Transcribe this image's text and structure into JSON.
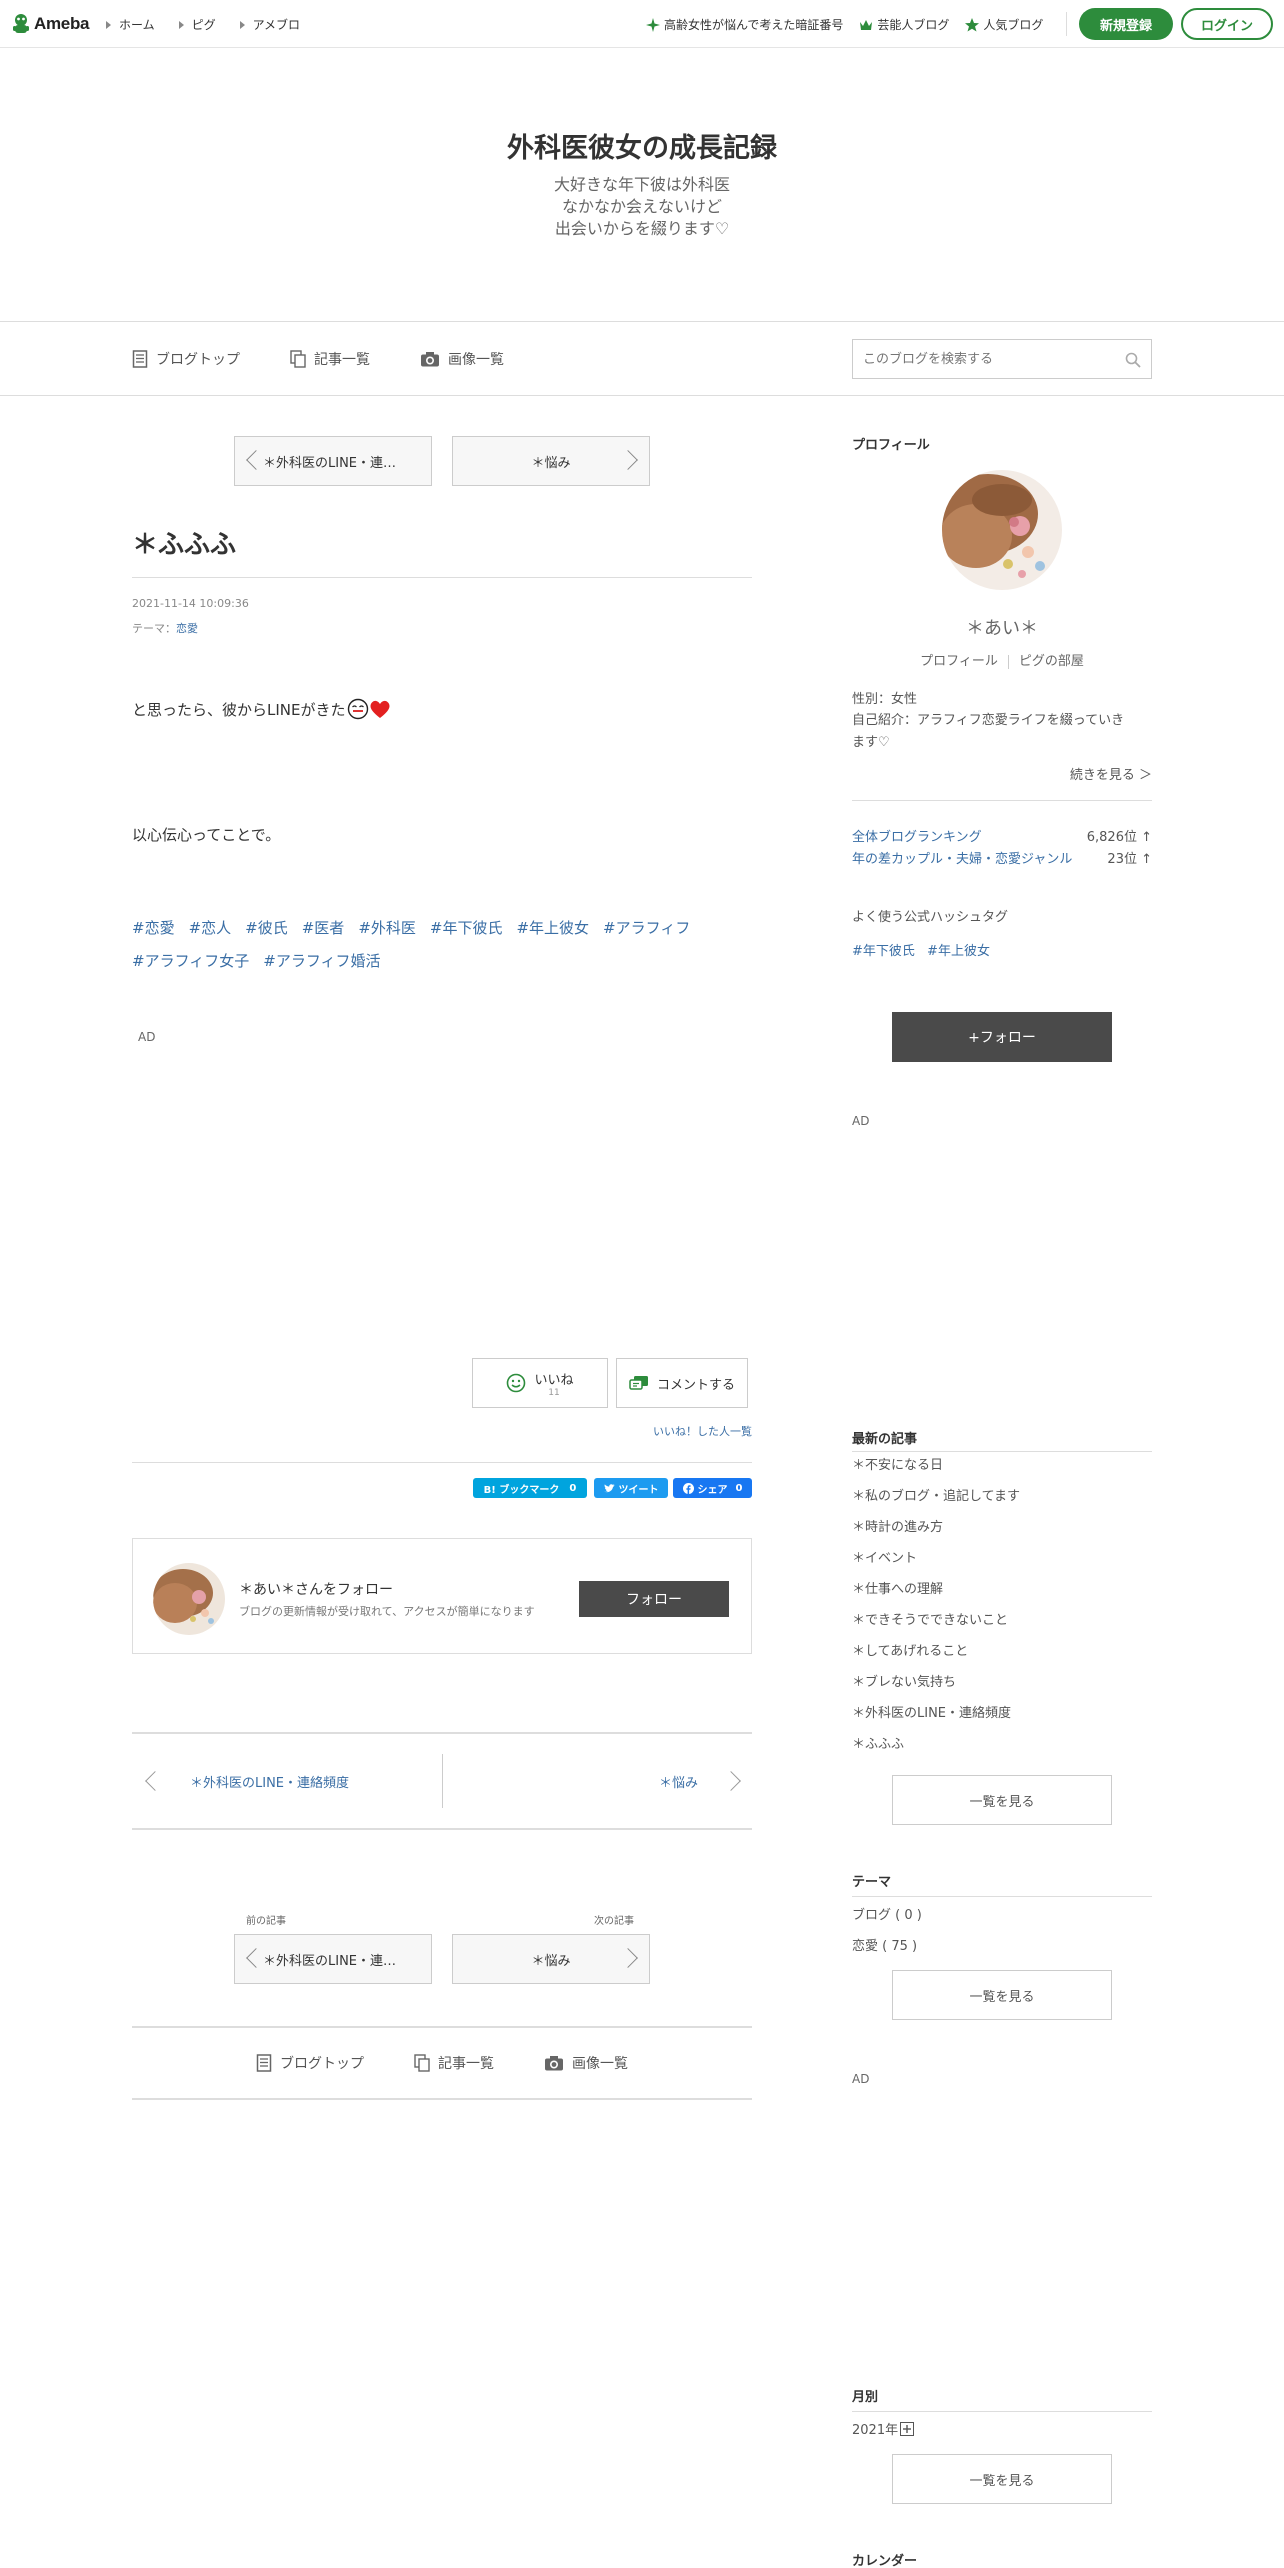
{
  "topbar": {
    "logo": "Ameba",
    "nav": [
      "ホーム",
      "ピグ",
      "アメブロ"
    ],
    "links": [
      "高齢女性が悩んで考えた暗証番号",
      "芸能人ブログ",
      "人気ブログ"
    ],
    "register": "新規登録",
    "login": "ログイン"
  },
  "header": {
    "title": "外科医彼女の成長記録",
    "desc": [
      "大好きな年下彼は外科医",
      "なかなか会えないけど",
      "出会いからを綴ります♡"
    ]
  },
  "subnav": {
    "tabs": [
      "ブログトップ",
      "記事一覧",
      "画像一覧"
    ],
    "search_placeholder": "このブログを検索する"
  },
  "entry": {
    "prev": "＊外科医のLINE・連絡頻度",
    "next": "＊悩み",
    "title": "＊ふふふ",
    "date": "2021-11-14 10:09:36",
    "theme_label": "テーマ：",
    "theme": "恋愛",
    "line1": "と思ったら、彼からLINEがきた",
    "line2": "以心伝心ってことで。",
    "hashtags": [
      "#恋愛",
      "#恋人",
      "#彼氏",
      "#医者",
      "#外科医",
      "#年下彼氏",
      "#年上彼女",
      "#アラフィフ",
      "#アラフィフ女子",
      "#アラフィフ婚活"
    ],
    "ad": "AD",
    "like_label": "いいね",
    "like_count": "11",
    "comment_label": "コメントする",
    "liked_list": "いいね！した人一覧",
    "share": {
      "hatena": "B! ブックマーク",
      "hatena_count": "0",
      "tweet": "ツイート",
      "fb": "シェア",
      "fb_count": "0"
    }
  },
  "follow": {
    "name": "＊あい＊さんをフォロー",
    "sub": "ブログの更新情報が受け取れて、アクセスが簡単になります",
    "button": "フォロー"
  },
  "bottom_pager": {
    "prev": "＊外科医のLINE・連絡頻度",
    "next": "＊悩み",
    "prev_label": "前の記事",
    "next_label": "次の記事"
  },
  "footer_tabs": [
    "ブログトップ",
    "記事一覧",
    "画像一覧"
  ],
  "sidebar": {
    "profile_heading": "プロフィール",
    "name": "＊あい＊",
    "profile_link": "プロフィール",
    "pig_link": "ピグの部屋",
    "gender": "性別：女性",
    "intro": [
      "自己紹介：アラフィフ恋愛ライフを綴っていき",
      "ます♡"
    ],
    "more": "続きを見る ＞",
    "ranking": [
      {
        "label": "全体ブログランキング",
        "value": "6,826位 ↑"
      },
      {
        "label": "年の差カップル・夫婦・恋愛ジャンル",
        "value": "23位 ↑"
      }
    ],
    "hashtag_heading": "よく使う公式ハッシュタグ",
    "hashtags": [
      "#年下彼氏",
      "#年上彼女"
    ],
    "follow_button": "+フォロー",
    "ad": "AD",
    "recent_heading": "最新の記事",
    "recent": [
      "＊不安になる日",
      "＊私のブログ・追記してます",
      "＊時計の進み方",
      "＊イベント",
      "＊仕事への理解",
      "＊できそうでできないこと",
      "＊してあげれること",
      "＊ブレない気持ち",
      "＊外科医のLINE・連絡頻度",
      "＊ふふふ"
    ],
    "see_all": "一覧を見る",
    "theme_heading": "テーマ",
    "themes": [
      "ブログ ( 0 )",
      "恋愛 ( 75 )"
    ],
    "ad2": "AD",
    "monthly_heading": "月別",
    "monthly_year": "2021年",
    "calendar_heading": "カレンダー"
  },
  "colors": {
    "brand_green": "#2d8c3c",
    "link": "#3a6ea5",
    "dark_button": "#4a4a4a",
    "hatena": "#00a4de",
    "twitter": "#1d9bf0",
    "facebook": "#1877f2"
  }
}
